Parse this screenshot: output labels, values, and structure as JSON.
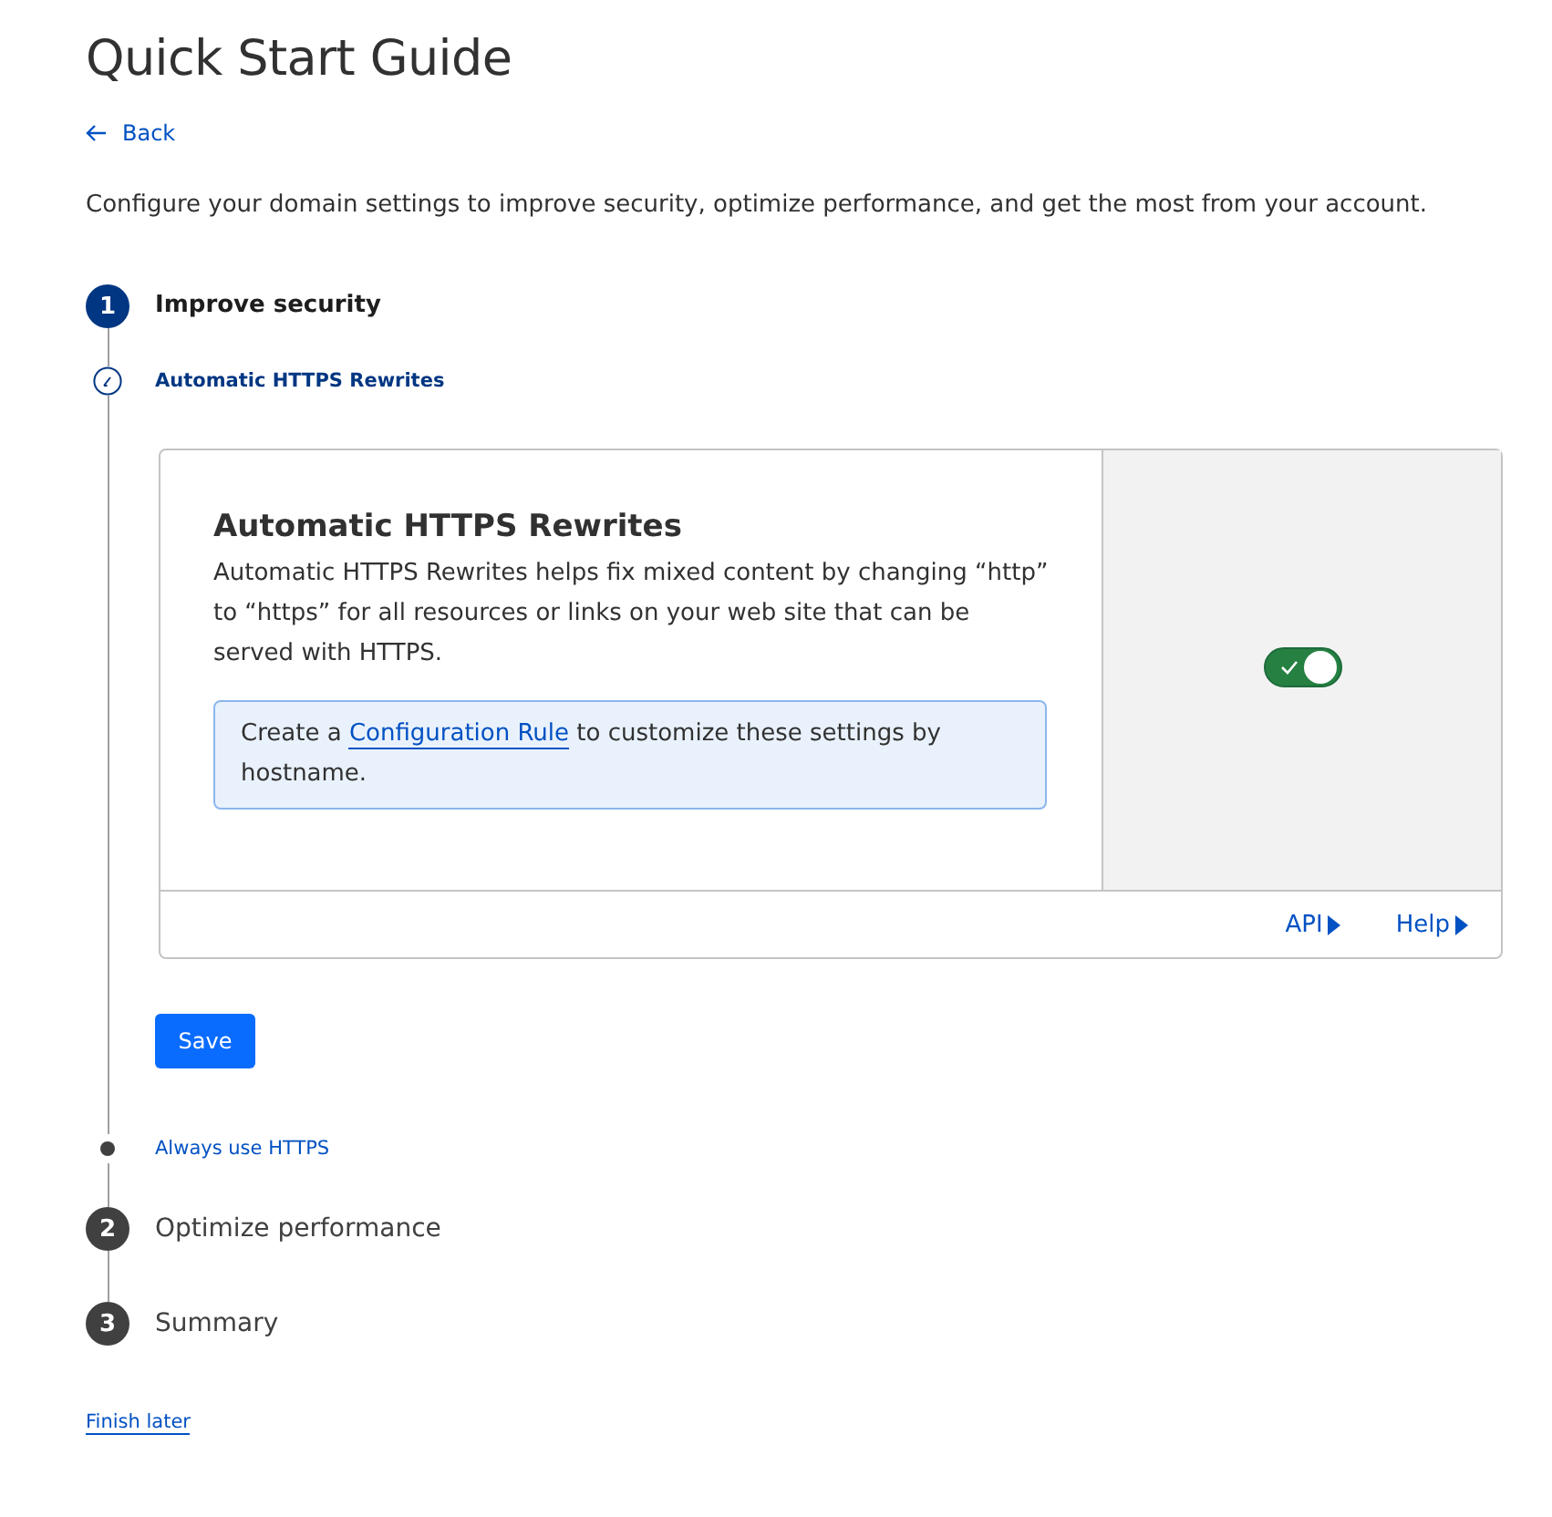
{
  "title": "Quick Start Guide",
  "back": "Back",
  "intro": "Configure your domain settings to improve security, optimize performance, and get the most from your account.",
  "steps": [
    {
      "number": "1",
      "label": "Improve security",
      "selected": true,
      "substeps": [
        {
          "label": "Automatic HTTPS Rewrites",
          "selected": true
        },
        {
          "label": "Always use HTTPS",
          "selected": false
        }
      ]
    },
    {
      "number": "2",
      "label": "Optimize performance",
      "selected": false
    },
    {
      "number": "3",
      "label": "Summary",
      "selected": false
    }
  ],
  "card": {
    "title": "Automatic HTTPS Rewrites",
    "description": "Automatic HTTPS Rewrites helps fix mixed content by changing “http” to “https” for all resources or links on your web site that can be served with HTTPS.",
    "note_before": "Create a ",
    "note_link": "Configuration Rule",
    "note_after": " to customize these settings by hostname.",
    "toggle_on": true,
    "links": [
      "API",
      "Help"
    ]
  },
  "save": "Save",
  "finish_later": "Finish later"
}
